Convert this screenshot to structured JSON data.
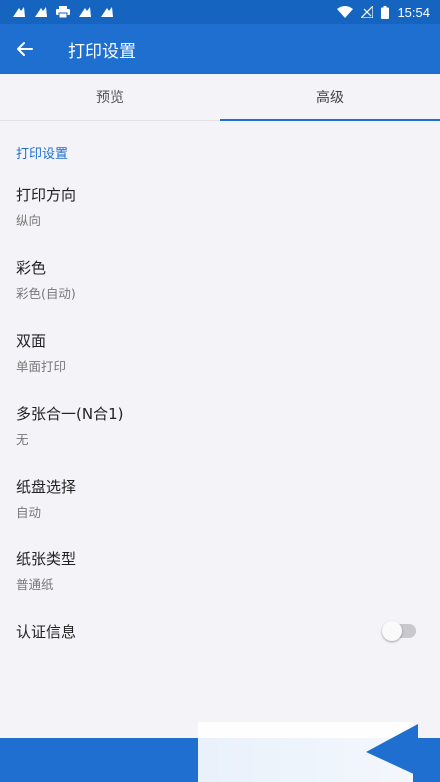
{
  "status_bar": {
    "time": "15:54",
    "colors": {
      "background": "#1565c0"
    }
  },
  "app_bar": {
    "title": "打印设置",
    "color": "#1e6fd0"
  },
  "tabs": [
    {
      "label": "预览",
      "active": false
    },
    {
      "label": "高级",
      "active": true
    }
  ],
  "section": {
    "title": "打印设置"
  },
  "settings": [
    {
      "title": "打印方向",
      "value": "纵向"
    },
    {
      "title": "彩色",
      "value": "彩色(自动)"
    },
    {
      "title": "双面",
      "value": "单面打印"
    },
    {
      "title": "多张合一(N合1)",
      "value": "无"
    },
    {
      "title": "纸盘选择",
      "value": "自动"
    },
    {
      "title": "纸张类型",
      "value": "普通纸"
    }
  ],
  "auth_info": {
    "title": "认证信息",
    "enabled": false
  },
  "icons": {
    "back": "arrow-left-icon",
    "status": [
      "notification-icon",
      "notification-icon",
      "printer-icon",
      "notification-icon",
      "notification-icon",
      "wifi-icon",
      "signal-off-icon",
      "battery-icon"
    ]
  }
}
